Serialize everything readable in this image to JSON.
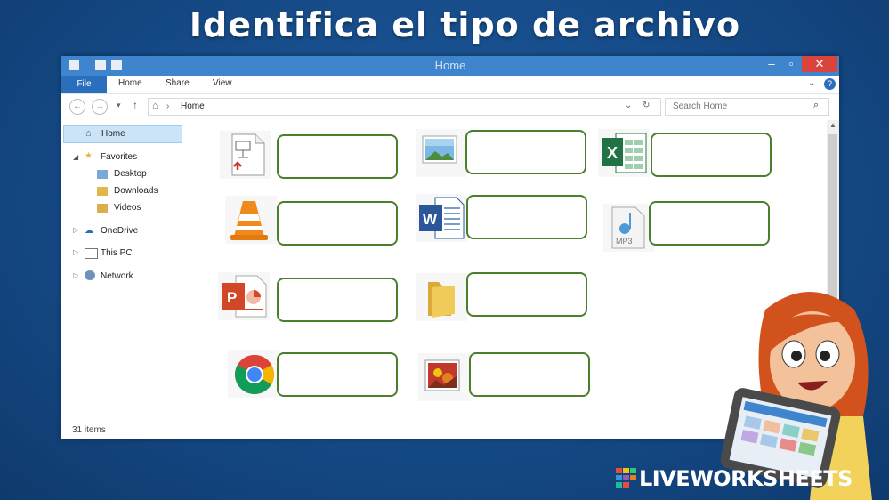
{
  "title": "Identifica el tipo de archivo",
  "window": {
    "title": "Home",
    "min": "–",
    "max": "▫",
    "close": "✕"
  },
  "ribbon": {
    "file": "File",
    "home": "Home",
    "share": "Share",
    "view": "View",
    "expand": "⌄",
    "help": "?"
  },
  "address": {
    "path": "Home",
    "search_placeholder": "Search Home",
    "back": "←",
    "forward": "→",
    "up": "↑"
  },
  "sidebar": {
    "items": [
      "Home",
      "Favorites",
      "Desktop",
      "Downloads",
      "Videos",
      "OneDrive",
      "This PC",
      "Network"
    ]
  },
  "status": "31 items",
  "files": {
    "mp3_label": "MP3",
    "word_letter": "W",
    "excel_letter": "X",
    "ppt_letter": "P"
  },
  "watermark": "LIVEWORKSHEETS",
  "colors": {
    "accent": "#3f85cd",
    "answer_border": "#4a7f2c",
    "background": "#154a86"
  }
}
